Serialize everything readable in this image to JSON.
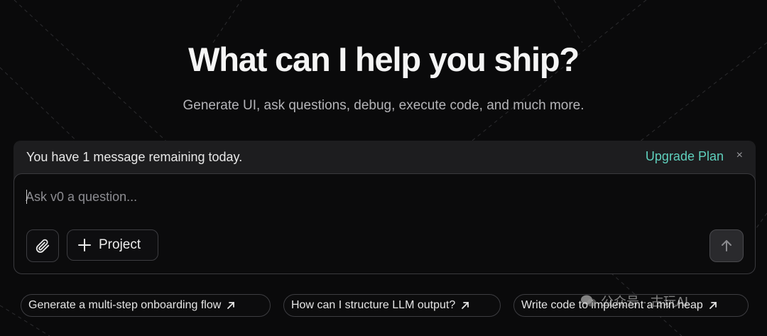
{
  "page": {
    "title": "What can I help you ship?",
    "subtitle": "Generate UI, ask questions, debug, execute code, and much more."
  },
  "banner": {
    "message": "You have 1 message remaining today.",
    "upgrade_label": "Upgrade Plan",
    "close_glyph": "×"
  },
  "composer": {
    "placeholder": "Ask v0 a question...",
    "value": "",
    "project_label": "Project",
    "attach_icon": "paperclip-icon",
    "add_icon": "plus-icon",
    "send_icon": "arrow-up-icon"
  },
  "suggestions": [
    {
      "label": "Generate a multi-step onboarding flow",
      "icon": "arrow-up-right-icon"
    },
    {
      "label": "How can I structure LLM output?",
      "icon": "arrow-up-right-icon"
    },
    {
      "label": "Write code to implement a min heap",
      "icon": "arrow-up-right-icon"
    }
  ],
  "watermark": {
    "text": "公众号 · 古玩AI"
  },
  "colors": {
    "background": "#0a0a0b",
    "banner": "#1d1d1f",
    "accent": "#5fd0bd",
    "border": "#3a3a3e"
  }
}
